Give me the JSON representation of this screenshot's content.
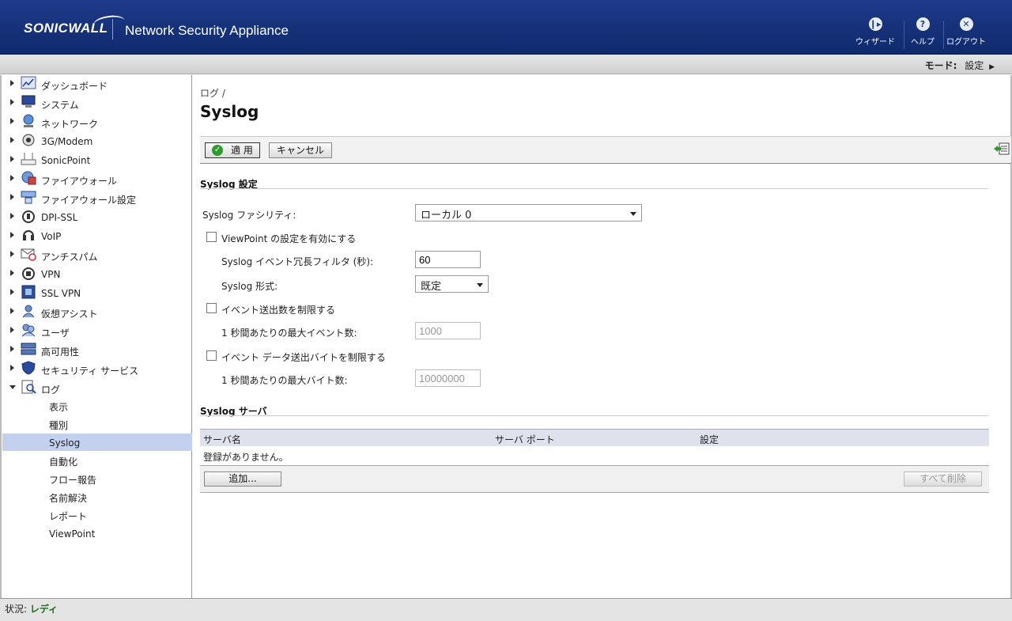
{
  "header": {
    "logo": "SONICWALL",
    "product": "Network Security Appliance",
    "buttons": [
      {
        "label": "ウィザード",
        "icon": "wizard-icon"
      },
      {
        "label": "ヘルプ",
        "icon": "help-icon"
      },
      {
        "label": "ログアウト",
        "icon": "logout-icon"
      }
    ]
  },
  "modebar": {
    "label": "モード:",
    "value": "設定"
  },
  "sidebar": {
    "items": [
      {
        "label": "ダッシュボード",
        "icon": "dashboard-icon"
      },
      {
        "label": "システム",
        "icon": "system-icon"
      },
      {
        "label": "ネットワーク",
        "icon": "network-icon"
      },
      {
        "label": "3G/Modem",
        "icon": "modem-icon"
      },
      {
        "label": "SonicPoint",
        "icon": "sonicpoint-icon"
      },
      {
        "label": "ファイアウォール",
        "icon": "firewall-icon"
      },
      {
        "label": "ファイアウォール設定",
        "icon": "firewall-settings-icon"
      },
      {
        "label": "DPI-SSL",
        "icon": "dpi-ssl-icon"
      },
      {
        "label": "VoIP",
        "icon": "voip-icon"
      },
      {
        "label": "アンチスパム",
        "icon": "antispam-icon"
      },
      {
        "label": "VPN",
        "icon": "vpn-icon"
      },
      {
        "label": "SSL VPN",
        "icon": "ssl-vpn-icon"
      },
      {
        "label": "仮想アシスト",
        "icon": "virtual-assist-icon"
      },
      {
        "label": "ユーザ",
        "icon": "users-icon"
      },
      {
        "label": "高可用性",
        "icon": "high-availability-icon"
      },
      {
        "label": "セキュリティ サービス",
        "icon": "security-services-icon"
      },
      {
        "label": "ログ",
        "icon": "log-icon"
      }
    ],
    "log_subitems": [
      {
        "label": "表示"
      },
      {
        "label": "種別"
      },
      {
        "label": "Syslog"
      },
      {
        "label": "自動化"
      },
      {
        "label": "フロー報告"
      },
      {
        "label": "名前解決"
      },
      {
        "label": "レポート"
      },
      {
        "label": "ViewPoint"
      }
    ]
  },
  "main": {
    "breadcrumb": "ログ /",
    "title": "Syslog",
    "toolbar": {
      "apply": "適 用",
      "cancel": "キャンセル",
      "export_icon": "export-icon"
    },
    "settings_section": "Syslog 設定",
    "facility_label": "Syslog ファシリティ:",
    "facility_value": "ローカル 0",
    "viewpoint_label": "ViewPoint の設定を有効にする",
    "redundancy_label": "Syslog イベント冗長フィルタ (秒):",
    "redundancy_value": "60",
    "format_label": "Syslog 形式:",
    "format_value": "既定",
    "limit_events_label": "イベント送出数を制限する",
    "max_events_label": "1 秒間あたりの最大イベント数:",
    "max_events_value": "1000",
    "limit_bytes_label": "イベント データ送出バイトを制限する",
    "max_bytes_label": "1 秒間あたりの最大バイト数:",
    "max_bytes_value": "10000000",
    "servers_section": "Syslog サーバ",
    "table_headers": [
      "サーバ名",
      "サーバ ポート",
      "設定"
    ],
    "empty_message": "登録がありません。",
    "add_button": "追加...",
    "delete_all_button": "すべて削除"
  },
  "statusbar": {
    "label": "状況:",
    "value": "レディ"
  }
}
